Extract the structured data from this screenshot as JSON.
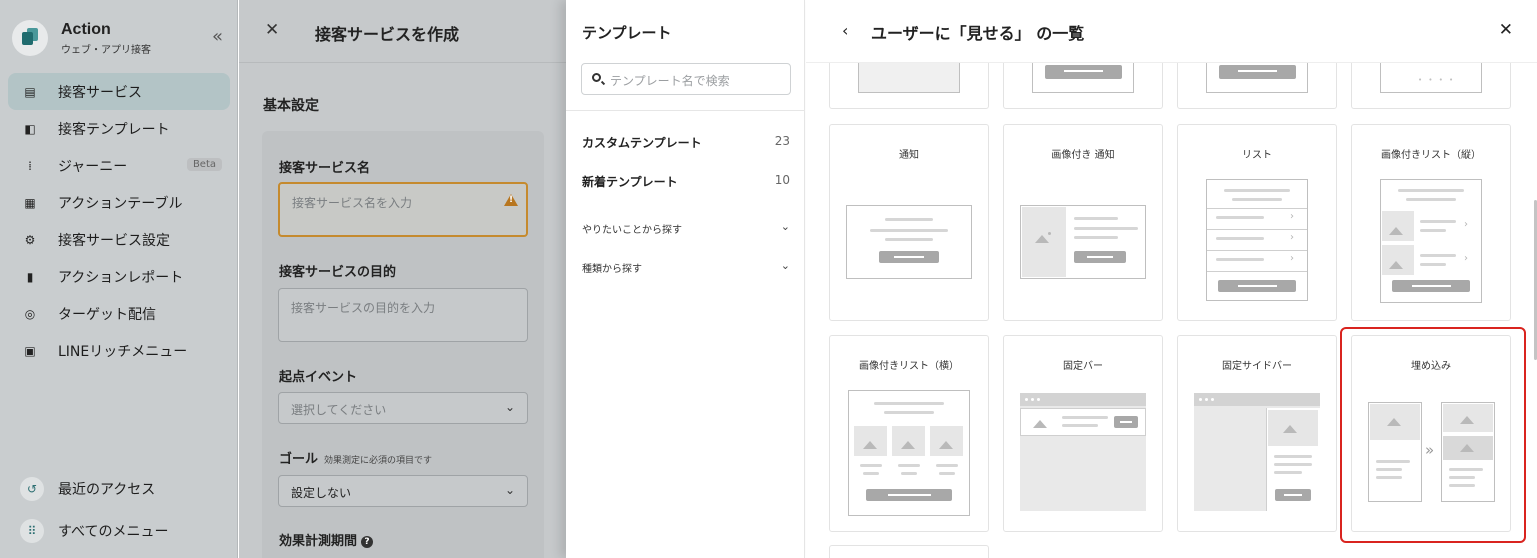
{
  "nav": {
    "brand_title": "Action",
    "brand_subtitle": "ウェブ・アプリ接客",
    "items": [
      {
        "label": "接客サービス",
        "icon": "document-icon",
        "active": true
      },
      {
        "label": "接客テンプレート",
        "icon": "template-icon"
      },
      {
        "label": "ジャーニー",
        "icon": "journey-icon",
        "badge": "Beta"
      },
      {
        "label": "アクションテーブル",
        "icon": "table-icon"
      },
      {
        "label": "接客サービス設定",
        "icon": "gears-icon"
      },
      {
        "label": "アクションレポート",
        "icon": "bar-chart-icon"
      },
      {
        "label": "ターゲット配信",
        "icon": "target-icon"
      },
      {
        "label": "LINEリッチメニュー",
        "icon": "line-menu-icon"
      }
    ],
    "bottom": [
      {
        "label": "最近のアクセス",
        "icon": "history-icon"
      },
      {
        "label": "すべてのメニュー",
        "icon": "grid-icon"
      }
    ]
  },
  "form": {
    "title": "接客サービスを作成",
    "section": "基本設定",
    "name_label": "接客サービス名",
    "name_placeholder": "接客サービス名を入力",
    "purpose_label": "接客サービスの目的",
    "purpose_placeholder": "接客サービスの目的を入力",
    "event_label": "起点イベント",
    "event_value": "選択してください",
    "goal_label": "ゴール",
    "goal_note": "効果測定に必須の項目です",
    "goal_value": "設定しない",
    "period_label": "効果計測期間"
  },
  "template_panel": {
    "title": "テンプレート",
    "search_placeholder": "テンプレート名で検索",
    "categories": [
      {
        "label": "カスタムテンプレート",
        "count": "23"
      },
      {
        "label": "新着テンプレート",
        "count": "10"
      }
    ],
    "filters": [
      {
        "label": "やりたいことから探す"
      },
      {
        "label": "種類から探す"
      }
    ]
  },
  "gallery": {
    "title": "ユーザーに「見せる」 の一覧",
    "tiles_row1": [
      "通知",
      "画像付き 通知",
      "リスト",
      "画像付きリスト（縦）"
    ],
    "tiles_row2": [
      "画像付きリスト（横）",
      "固定バー",
      "固定サイドバー",
      "埋め込み"
    ],
    "selected": "埋め込み"
  }
}
